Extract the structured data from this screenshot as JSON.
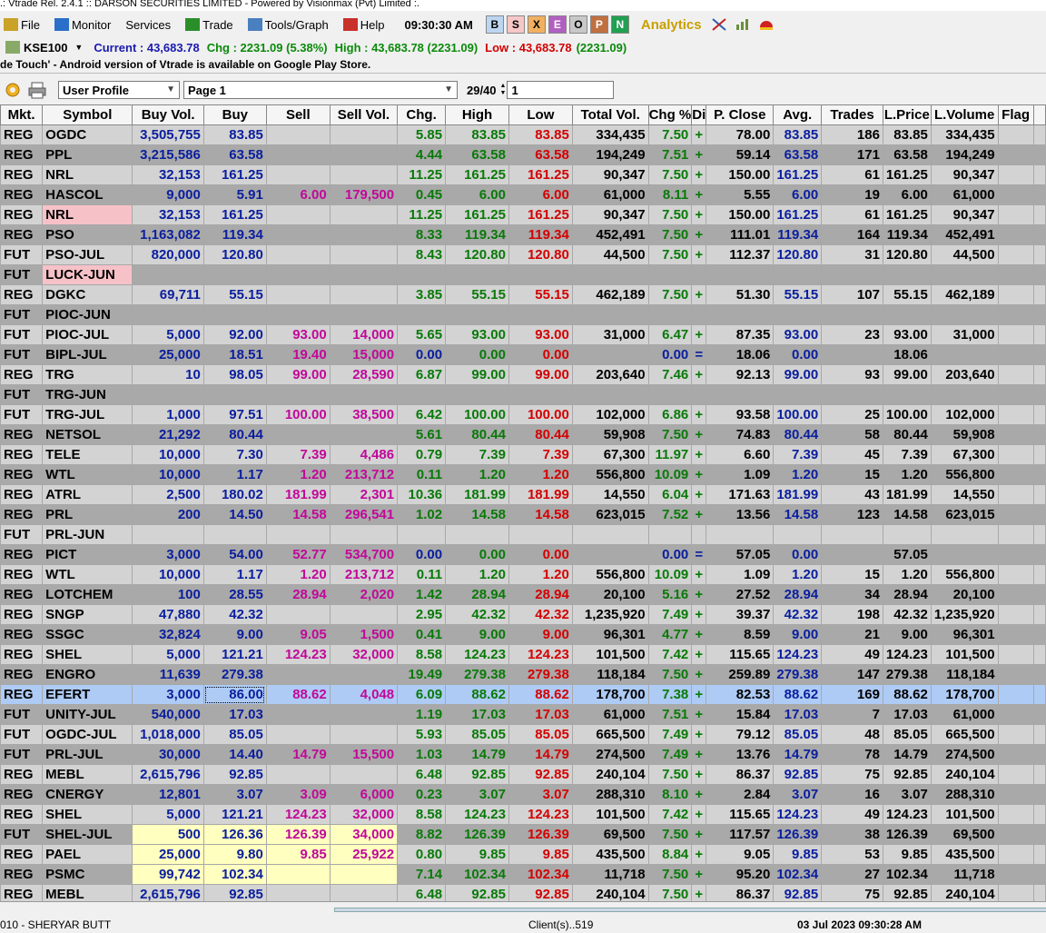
{
  "window": {
    "title": ".: Vtrade Rel. 2.4.1 :: DARSON SECURITIES LIMITED - Powered by Visionmax (Pvt) Limited :."
  },
  "menu": {
    "items": [
      {
        "label": "File",
        "icon": "file-icon",
        "color": "#c9a227"
      },
      {
        "label": "Monitor",
        "icon": "monitor-icon",
        "color": "#2a6fc9"
      },
      {
        "label": "Services",
        "icon": "",
        "color": ""
      },
      {
        "label": "Trade",
        "icon": "trade-icon",
        "color": "#2a8f2a"
      },
      {
        "label": "Tools/Graph",
        "icon": "tools-icon",
        "color": "#4a7fc0"
      },
      {
        "label": "Help",
        "icon": "help-icon",
        "color": "#c8302a"
      }
    ],
    "clock": "09:30:30 AM",
    "letter_buttons": [
      {
        "label": "B",
        "bg": "#bcd6f2",
        "fg": "#000"
      },
      {
        "label": "S",
        "bg": "#f7c7c7",
        "fg": "#000"
      },
      {
        "label": "X",
        "bg": "#f0b060",
        "fg": "#000"
      },
      {
        "label": "E",
        "bg": "#b060c0",
        "fg": "#fff"
      },
      {
        "label": "O",
        "bg": "#c8c8c8",
        "fg": "#000"
      },
      {
        "label": "P",
        "bg": "#c07040",
        "fg": "#fff"
      },
      {
        "label": "N",
        "bg": "#20a050",
        "fg": "#fff"
      }
    ],
    "analytics": "Analytics"
  },
  "index": {
    "name": "KSE100",
    "current": "Current : 43,683.78",
    "chg": "Chg : 2231.09 (5.38%)",
    "high": "High : 43,683.78 (2231.09)",
    "low": "Low : 43,683.78",
    "low_chg": "(2231.09)"
  },
  "ticker": "de Touch' - Android version of Vtrade is available on Google Play Store.",
  "toolbar": {
    "profile": "User Profile",
    "page": "Page 1",
    "page_count": "29/40",
    "page_input": "1"
  },
  "columns": [
    "Mkt.",
    "Symbol",
    "Buy Vol.",
    "Buy",
    "Sell",
    "Sell Vol.",
    "Chg.",
    "High",
    "Low",
    "Total Vol.",
    "Chg %",
    "Di",
    "P. Close",
    "Avg.",
    "Trades",
    "L.Price",
    "L.Volume",
    "Flag"
  ],
  "rows": [
    [
      "REG",
      "OGDC",
      "3,505,755",
      "83.85",
      "",
      "",
      "5.85",
      "83.85",
      "83.85",
      "334,435",
      "7.50",
      "+",
      "78.00",
      "83.85",
      "186",
      "83.85",
      "334,435",
      ""
    ],
    [
      "REG",
      "PPL",
      "3,215,586",
      "63.58",
      "",
      "",
      "4.44",
      "63.58",
      "63.58",
      "194,249",
      "7.51",
      "+",
      "59.14",
      "63.58",
      "171",
      "63.58",
      "194,249",
      ""
    ],
    [
      "REG",
      "NRL",
      "32,153",
      "161.25",
      "",
      "",
      "11.25",
      "161.25",
      "161.25",
      "90,347",
      "7.50",
      "+",
      "150.00",
      "161.25",
      "61",
      "161.25",
      "90,347",
      ""
    ],
    [
      "REG",
      "HASCOL",
      "9,000",
      "5.91",
      "6.00",
      "179,500",
      "0.45",
      "6.00",
      "6.00",
      "61,000",
      "8.11",
      "+",
      "5.55",
      "6.00",
      "19",
      "6.00",
      "61,000",
      ""
    ],
    [
      "REG",
      "NRL",
      "32,153",
      "161.25",
      "",
      "",
      "11.25",
      "161.25",
      "161.25",
      "90,347",
      "7.50",
      "+",
      "150.00",
      "161.25",
      "61",
      "161.25",
      "90,347",
      ""
    ],
    [
      "REG",
      "PSO",
      "1,163,082",
      "119.34",
      "",
      "",
      "8.33",
      "119.34",
      "119.34",
      "452,491",
      "7.50",
      "+",
      "111.01",
      "119.34",
      "164",
      "119.34",
      "452,491",
      ""
    ],
    [
      "FUT",
      "PSO-JUL",
      "820,000",
      "120.80",
      "",
      "",
      "8.43",
      "120.80",
      "120.80",
      "44,500",
      "7.50",
      "+",
      "112.37",
      "120.80",
      "31",
      "120.80",
      "44,500",
      ""
    ],
    [
      "FUT",
      "LUCK-JUN",
      "",
      "",
      "",
      "",
      "",
      "",
      "",
      "",
      "",
      "",
      "",
      "",
      "",
      "",
      "",
      ""
    ],
    [
      "REG",
      "DGKC",
      "69,711",
      "55.15",
      "",
      "",
      "3.85",
      "55.15",
      "55.15",
      "462,189",
      "7.50",
      "+",
      "51.30",
      "55.15",
      "107",
      "55.15",
      "462,189",
      ""
    ],
    [
      "FUT",
      "PIOC-JUN",
      "",
      "",
      "",
      "",
      "",
      "",
      "",
      "",
      "",
      "",
      "",
      "",
      "",
      "",
      "",
      ""
    ],
    [
      "FUT",
      "PIOC-JUL",
      "5,000",
      "92.00",
      "93.00",
      "14,000",
      "5.65",
      "93.00",
      "93.00",
      "31,000",
      "6.47",
      "+",
      "87.35",
      "93.00",
      "23",
      "93.00",
      "31,000",
      ""
    ],
    [
      "FUT",
      "BIPL-JUL",
      "25,000",
      "18.51",
      "19.40",
      "15,000",
      "0.00",
      "0.00",
      "0.00",
      "",
      "0.00",
      "=",
      "18.06",
      "0.00",
      "",
      "18.06",
      "",
      ""
    ],
    [
      "REG",
      "TRG",
      "10",
      "98.05",
      "99.00",
      "28,590",
      "6.87",
      "99.00",
      "99.00",
      "203,640",
      "7.46",
      "+",
      "92.13",
      "99.00",
      "93",
      "99.00",
      "203,640",
      ""
    ],
    [
      "FUT",
      "TRG-JUN",
      "",
      "",
      "",
      "",
      "",
      "",
      "",
      "",
      "",
      "",
      "",
      "",
      "",
      "",
      "",
      ""
    ],
    [
      "FUT",
      "TRG-JUL",
      "1,000",
      "97.51",
      "100.00",
      "38,500",
      "6.42",
      "100.00",
      "100.00",
      "102,000",
      "6.86",
      "+",
      "93.58",
      "100.00",
      "25",
      "100.00",
      "102,000",
      ""
    ],
    [
      "REG",
      "NETSOL",
      "21,292",
      "80.44",
      "",
      "",
      "5.61",
      "80.44",
      "80.44",
      "59,908",
      "7.50",
      "+",
      "74.83",
      "80.44",
      "58",
      "80.44",
      "59,908",
      ""
    ],
    [
      "REG",
      "TELE",
      "10,000",
      "7.30",
      "7.39",
      "4,486",
      "0.79",
      "7.39",
      "7.39",
      "67,300",
      "11.97",
      "+",
      "6.60",
      "7.39",
      "45",
      "7.39",
      "67,300",
      ""
    ],
    [
      "REG",
      "WTL",
      "10,000",
      "1.17",
      "1.20",
      "213,712",
      "0.11",
      "1.20",
      "1.20",
      "556,800",
      "10.09",
      "+",
      "1.09",
      "1.20",
      "15",
      "1.20",
      "556,800",
      ""
    ],
    [
      "REG",
      "ATRL",
      "2,500",
      "180.02",
      "181.99",
      "2,301",
      "10.36",
      "181.99",
      "181.99",
      "14,550",
      "6.04",
      "+",
      "171.63",
      "181.99",
      "43",
      "181.99",
      "14,550",
      ""
    ],
    [
      "REG",
      "PRL",
      "200",
      "14.50",
      "14.58",
      "296,541",
      "1.02",
      "14.58",
      "14.58",
      "623,015",
      "7.52",
      "+",
      "13.56",
      "14.58",
      "123",
      "14.58",
      "623,015",
      ""
    ],
    [
      "FUT",
      "PRL-JUN",
      "",
      "",
      "",
      "",
      "",
      "",
      "",
      "",
      "",
      "",
      "",
      "",
      "",
      "",
      "",
      ""
    ],
    [
      "REG",
      "PICT",
      "3,000",
      "54.00",
      "52.77",
      "534,700",
      "0.00",
      "0.00",
      "0.00",
      "",
      "0.00",
      "=",
      "57.05",
      "0.00",
      "",
      "57.05",
      "",
      ""
    ],
    [
      "REG",
      "WTL",
      "10,000",
      "1.17",
      "1.20",
      "213,712",
      "0.11",
      "1.20",
      "1.20",
      "556,800",
      "10.09",
      "+",
      "1.09",
      "1.20",
      "15",
      "1.20",
      "556,800",
      ""
    ],
    [
      "REG",
      "LOTCHEM",
      "100",
      "28.55",
      "28.94",
      "2,020",
      "1.42",
      "28.94",
      "28.94",
      "20,100",
      "5.16",
      "+",
      "27.52",
      "28.94",
      "34",
      "28.94",
      "20,100",
      ""
    ],
    [
      "REG",
      "SNGP",
      "47,880",
      "42.32",
      "",
      "",
      "2.95",
      "42.32",
      "42.32",
      "1,235,920",
      "7.49",
      "+",
      "39.37",
      "42.32",
      "198",
      "42.32",
      "1,235,920",
      ""
    ],
    [
      "REG",
      "SSGC",
      "32,824",
      "9.00",
      "9.05",
      "1,500",
      "0.41",
      "9.00",
      "9.00",
      "96,301",
      "4.77",
      "+",
      "8.59",
      "9.00",
      "21",
      "9.00",
      "96,301",
      ""
    ],
    [
      "REG",
      "SHEL",
      "5,000",
      "121.21",
      "124.23",
      "32,000",
      "8.58",
      "124.23",
      "124.23",
      "101,500",
      "7.42",
      "+",
      "115.65",
      "124.23",
      "49",
      "124.23",
      "101,500",
      ""
    ],
    [
      "REG",
      "ENGRO",
      "11,639",
      "279.38",
      "",
      "",
      "19.49",
      "279.38",
      "279.38",
      "118,184",
      "7.50",
      "+",
      "259.89",
      "279.38",
      "147",
      "279.38",
      "118,184",
      ""
    ],
    [
      "REG",
      "EFERT",
      "3,000",
      "86.00",
      "88.62",
      "4,048",
      "6.09",
      "88.62",
      "88.62",
      "178,700",
      "7.38",
      "+",
      "82.53",
      "88.62",
      "169",
      "88.62",
      "178,700",
      ""
    ],
    [
      "FUT",
      "UNITY-JUL",
      "540,000",
      "17.03",
      "",
      "",
      "1.19",
      "17.03",
      "17.03",
      "61,000",
      "7.51",
      "+",
      "15.84",
      "17.03",
      "7",
      "17.03",
      "61,000",
      ""
    ],
    [
      "FUT",
      "OGDC-JUL",
      "1,018,000",
      "85.05",
      "",
      "",
      "5.93",
      "85.05",
      "85.05",
      "665,500",
      "7.49",
      "+",
      "79.12",
      "85.05",
      "48",
      "85.05",
      "665,500",
      ""
    ],
    [
      "FUT",
      "PRL-JUL",
      "30,000",
      "14.40",
      "14.79",
      "15,500",
      "1.03",
      "14.79",
      "14.79",
      "274,500",
      "7.49",
      "+",
      "13.76",
      "14.79",
      "78",
      "14.79",
      "274,500",
      ""
    ],
    [
      "REG",
      "MEBL",
      "2,615,796",
      "92.85",
      "",
      "",
      "6.48",
      "92.85",
      "92.85",
      "240,104",
      "7.50",
      "+",
      "86.37",
      "92.85",
      "75",
      "92.85",
      "240,104",
      ""
    ],
    [
      "REG",
      "CNERGY",
      "12,801",
      "3.07",
      "3.09",
      "6,000",
      "0.23",
      "3.07",
      "3.07",
      "288,310",
      "8.10",
      "+",
      "2.84",
      "3.07",
      "16",
      "3.07",
      "288,310",
      ""
    ],
    [
      "REG",
      "SHEL",
      "5,000",
      "121.21",
      "124.23",
      "32,000",
      "8.58",
      "124.23",
      "124.23",
      "101,500",
      "7.42",
      "+",
      "115.65",
      "124.23",
      "49",
      "124.23",
      "101,500",
      ""
    ],
    [
      "FUT",
      "SHEL-JUL",
      "500",
      "126.36",
      "126.39",
      "34,000",
      "8.82",
      "126.39",
      "126.39",
      "69,500",
      "7.50",
      "+",
      "117.57",
      "126.39",
      "38",
      "126.39",
      "69,500",
      ""
    ],
    [
      "REG",
      "PAEL",
      "25,000",
      "9.80",
      "9.85",
      "25,922",
      "0.80",
      "9.85",
      "9.85",
      "435,500",
      "8.84",
      "+",
      "9.05",
      "9.85",
      "53",
      "9.85",
      "435,500",
      ""
    ],
    [
      "REG",
      "PSMC",
      "99,742",
      "102.34",
      "",
      "",
      "7.14",
      "102.34",
      "102.34",
      "11,718",
      "7.50",
      "+",
      "95.20",
      "102.34",
      "27",
      "102.34",
      "11,718",
      ""
    ],
    [
      "REG",
      "MEBL",
      "2,615,796",
      "92.85",
      "",
      "",
      "6.48",
      "92.85",
      "92.85",
      "240,104",
      "7.50",
      "+",
      "86.37",
      "92.85",
      "75",
      "92.85",
      "240,104",
      ""
    ]
  ],
  "selected_row": 28,
  "pink_symbol_rows": [
    4,
    7
  ],
  "yellow_rows": [
    35,
    36,
    37
  ],
  "status": {
    "user": "010 - SHERYAR BUTT",
    "clients": "Client(s)..519",
    "datetime": "03 Jul 2023 09:30:28 AM"
  }
}
